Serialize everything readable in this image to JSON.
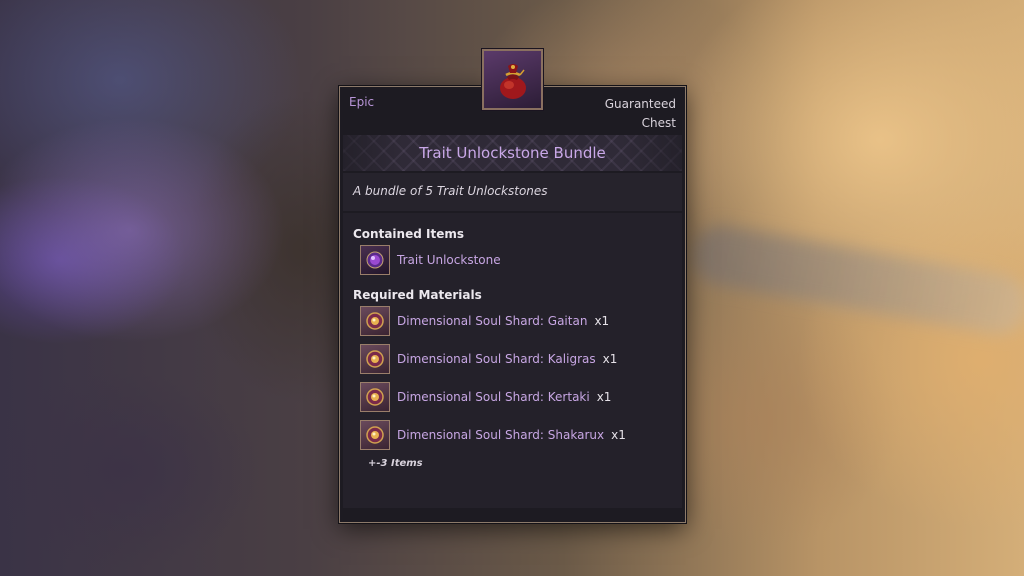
{
  "tooltip": {
    "grade": "Epic",
    "item_type": "Guaranteed Chest",
    "item_name": "Trait Unlockstone Bundle",
    "item_icon": "red-pouch-icon",
    "description": "A bundle of 5 Trait Unlockstones",
    "contained": {
      "title": "Contained Items",
      "items": [
        {
          "label": "Trait Unlockstone",
          "icon": "purple-gem-icon"
        }
      ]
    },
    "required": {
      "title": "Required Materials",
      "items": [
        {
          "label": "Dimensional Soul Shard: Gaitan",
          "qty": "x1",
          "icon": "soul-shard-icon"
        },
        {
          "label": "Dimensional Soul Shard: Kaligras",
          "qty": "x1",
          "icon": "soul-shard-icon"
        },
        {
          "label": "Dimensional Soul Shard: Kertaki",
          "qty": "x1",
          "icon": "soul-shard-icon"
        },
        {
          "label": "Dimensional Soul Shard: Shakarux",
          "qty": "x1",
          "icon": "soul-shard-icon"
        }
      ],
      "more_label": "+-3 Items"
    },
    "colors": {
      "grade": "#b894d8",
      "item_name": "#c9a8e8",
      "item_label": "#c7a6e3"
    }
  }
}
